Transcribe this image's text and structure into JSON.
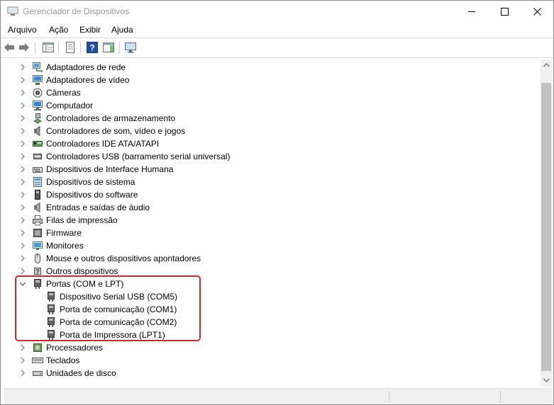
{
  "window": {
    "title": "Gerenciador de Dispositivos"
  },
  "menu": {
    "items": [
      "Arquivo",
      "Ação",
      "Exibir",
      "Ajuda"
    ]
  },
  "tree": {
    "categories": [
      {
        "label": "Adaptadores de rede",
        "icon": "network-adapter-icon"
      },
      {
        "label": "Adaptadores de vídeo",
        "icon": "display-adapter-icon"
      },
      {
        "label": "Câmeras",
        "icon": "camera-icon"
      },
      {
        "label": "Computador",
        "icon": "computer-icon"
      },
      {
        "label": "Controladores de armazenamento",
        "icon": "storage-controller-icon"
      },
      {
        "label": "Controladores de som, vídeo e jogos",
        "icon": "speaker-icon"
      },
      {
        "label": "Controladores IDE ATA/ATAPI",
        "icon": "ide-controller-icon"
      },
      {
        "label": "Controladores USB (barramento serial universal)",
        "icon": "usb-icon"
      },
      {
        "label": "Dispositivos de Interface Humana",
        "icon": "hid-icon"
      },
      {
        "label": "Dispositivos de sistema",
        "icon": "system-device-icon"
      },
      {
        "label": "Dispositivos do software",
        "icon": "software-device-icon"
      },
      {
        "label": "Entradas e saídas de áudio",
        "icon": "audio-io-icon"
      },
      {
        "label": "Filas de impressão",
        "icon": "print-queue-icon"
      },
      {
        "label": "Firmware",
        "icon": "firmware-icon"
      },
      {
        "label": "Monitores",
        "icon": "monitor-icon"
      },
      {
        "label": "Mouse e outros dispositivos apontadores",
        "icon": "mouse-icon"
      },
      {
        "label": "Outros dispositivos",
        "icon": "unknown-device-icon"
      },
      {
        "label": "Portas (COM e LPT)",
        "icon": "port-icon",
        "expanded": true
      },
      {
        "label": "Processadores",
        "icon": "processor-icon"
      },
      {
        "label": "Teclados",
        "icon": "keyboard-icon"
      },
      {
        "label": "Unidades de disco",
        "icon": "disk-drive-icon"
      }
    ],
    "ports_children": [
      "Dispositivo Serial USB (COM5)",
      "Porta de comunicação (COM1)",
      "Porta de comunicação (COM2)",
      "Porta de Impressora (LPT1)"
    ]
  },
  "colors": {
    "highlight_border": "#d9262c",
    "help_icon": "#1f4fa8"
  }
}
